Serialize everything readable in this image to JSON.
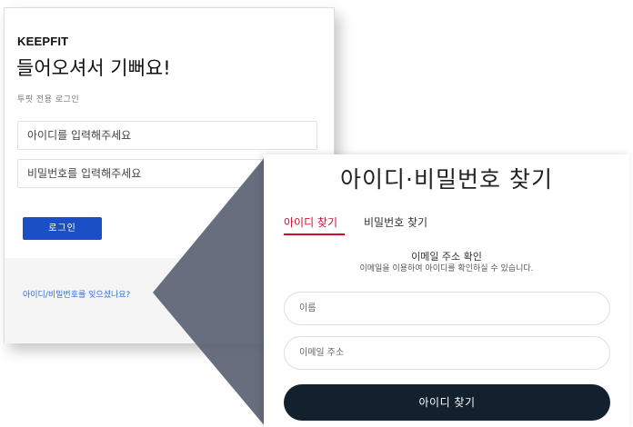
{
  "login": {
    "brand": "KEEPFIT",
    "welcome": "들어오셔서 기뻐요!",
    "subtitle": "투핏 전용 로그인",
    "id_placeholder": "아이디를 입력해주세요",
    "pw_placeholder": "비밀번호를 입력해주세요",
    "login_button": "로그인",
    "forgot_link": "아이디/비밀번호를 잊으셨나요?"
  },
  "find": {
    "title": "아이디·비밀번호 찾기",
    "tabs": [
      {
        "label": "아이디 찾기",
        "active": true
      },
      {
        "label": "비밀번호 찾기",
        "active": false
      }
    ],
    "section_heading": "이메일 주소 확인",
    "section_desc": "이메일을 이용하여 아이디를 확인하실 수 있습니다.",
    "name_placeholder": "이름",
    "email_placeholder": "이메일 주소",
    "submit_button": "아이디 찾기"
  },
  "colors": {
    "login_button": "#1a4fc6",
    "active_tab": "#c8102e",
    "submit_button": "#13202e",
    "connector": "#5f6677",
    "link": "#2e6fd6"
  }
}
